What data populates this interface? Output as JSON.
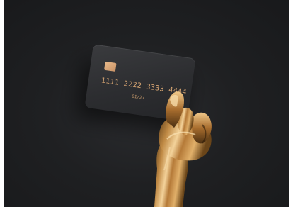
{
  "card": {
    "number": "1111 2222 3333 4444",
    "expiry": "01/27"
  },
  "colors": {
    "background": "#1f2022",
    "card": "#2c2d30",
    "accent_gold": "#d6a472"
  }
}
